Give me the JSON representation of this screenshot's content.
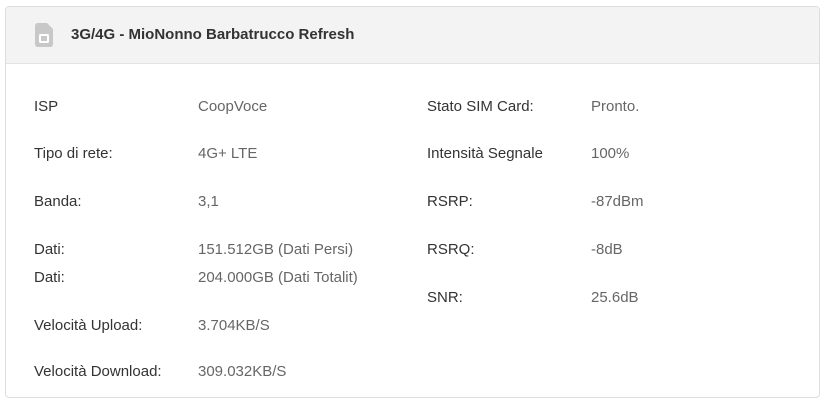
{
  "header": {
    "title": "3G/4G - MioNonno Barbatrucco Refresh",
    "icon": "sim-card-icon"
  },
  "left_rows": [
    {
      "label": "ISP",
      "value": "CoopVoce"
    },
    {
      "label": "Tipo di rete:",
      "value": "4G+ LTE"
    },
    {
      "label": "Banda:",
      "value": "3,1"
    },
    {
      "label": "Dati:",
      "value": "151.512GB (Dati Persi)"
    },
    {
      "label": "Dati:",
      "value": "204.000GB (Dati Totalit)"
    },
    {
      "label": "Velocità Upload:",
      "value": "3.704KB/S"
    },
    {
      "label": "Velocità Download:",
      "value": "309.032KB/S"
    }
  ],
  "right_rows": [
    {
      "label": "Stato SIM Card:",
      "value": "Pronto."
    },
    {
      "label": "Intensità Segnale",
      "value": "100%"
    },
    {
      "label": "RSRP:",
      "value": "-87dBm"
    },
    {
      "label": "RSRQ:",
      "value": "-8dB"
    },
    {
      "label": "SNR:",
      "value": "25.6dB"
    }
  ]
}
